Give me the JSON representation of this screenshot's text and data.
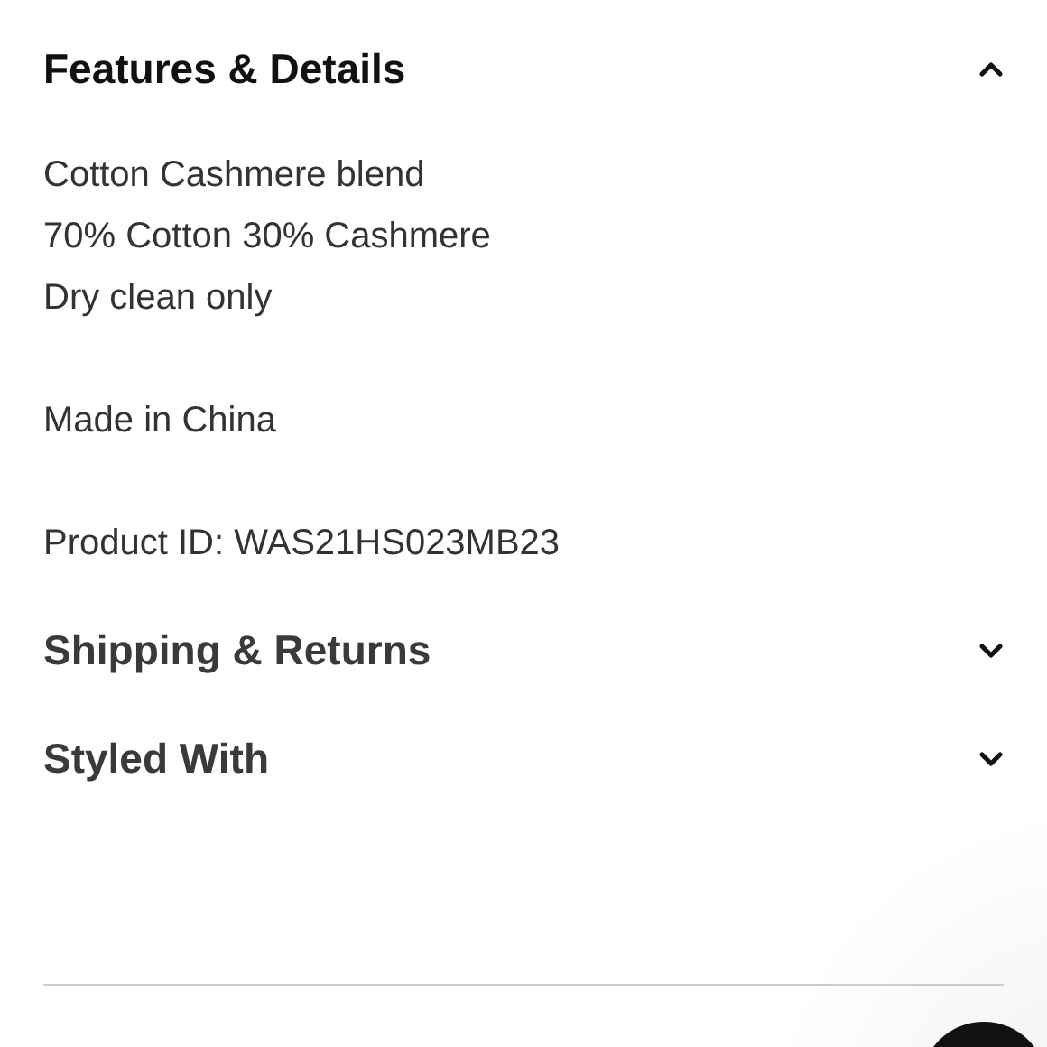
{
  "sections": [
    {
      "title": "Features & Details",
      "expanded": true,
      "paragraphs": [
        [
          "Cotton Cashmere blend",
          "70% Cotton 30% Cashmere",
          "Dry clean only"
        ],
        [
          "Made in China"
        ],
        [
          "Product ID: WAS21HS023MB23"
        ]
      ]
    },
    {
      "title": "Shipping & Returns",
      "expanded": false
    },
    {
      "title": "Styled With",
      "expanded": false
    }
  ]
}
